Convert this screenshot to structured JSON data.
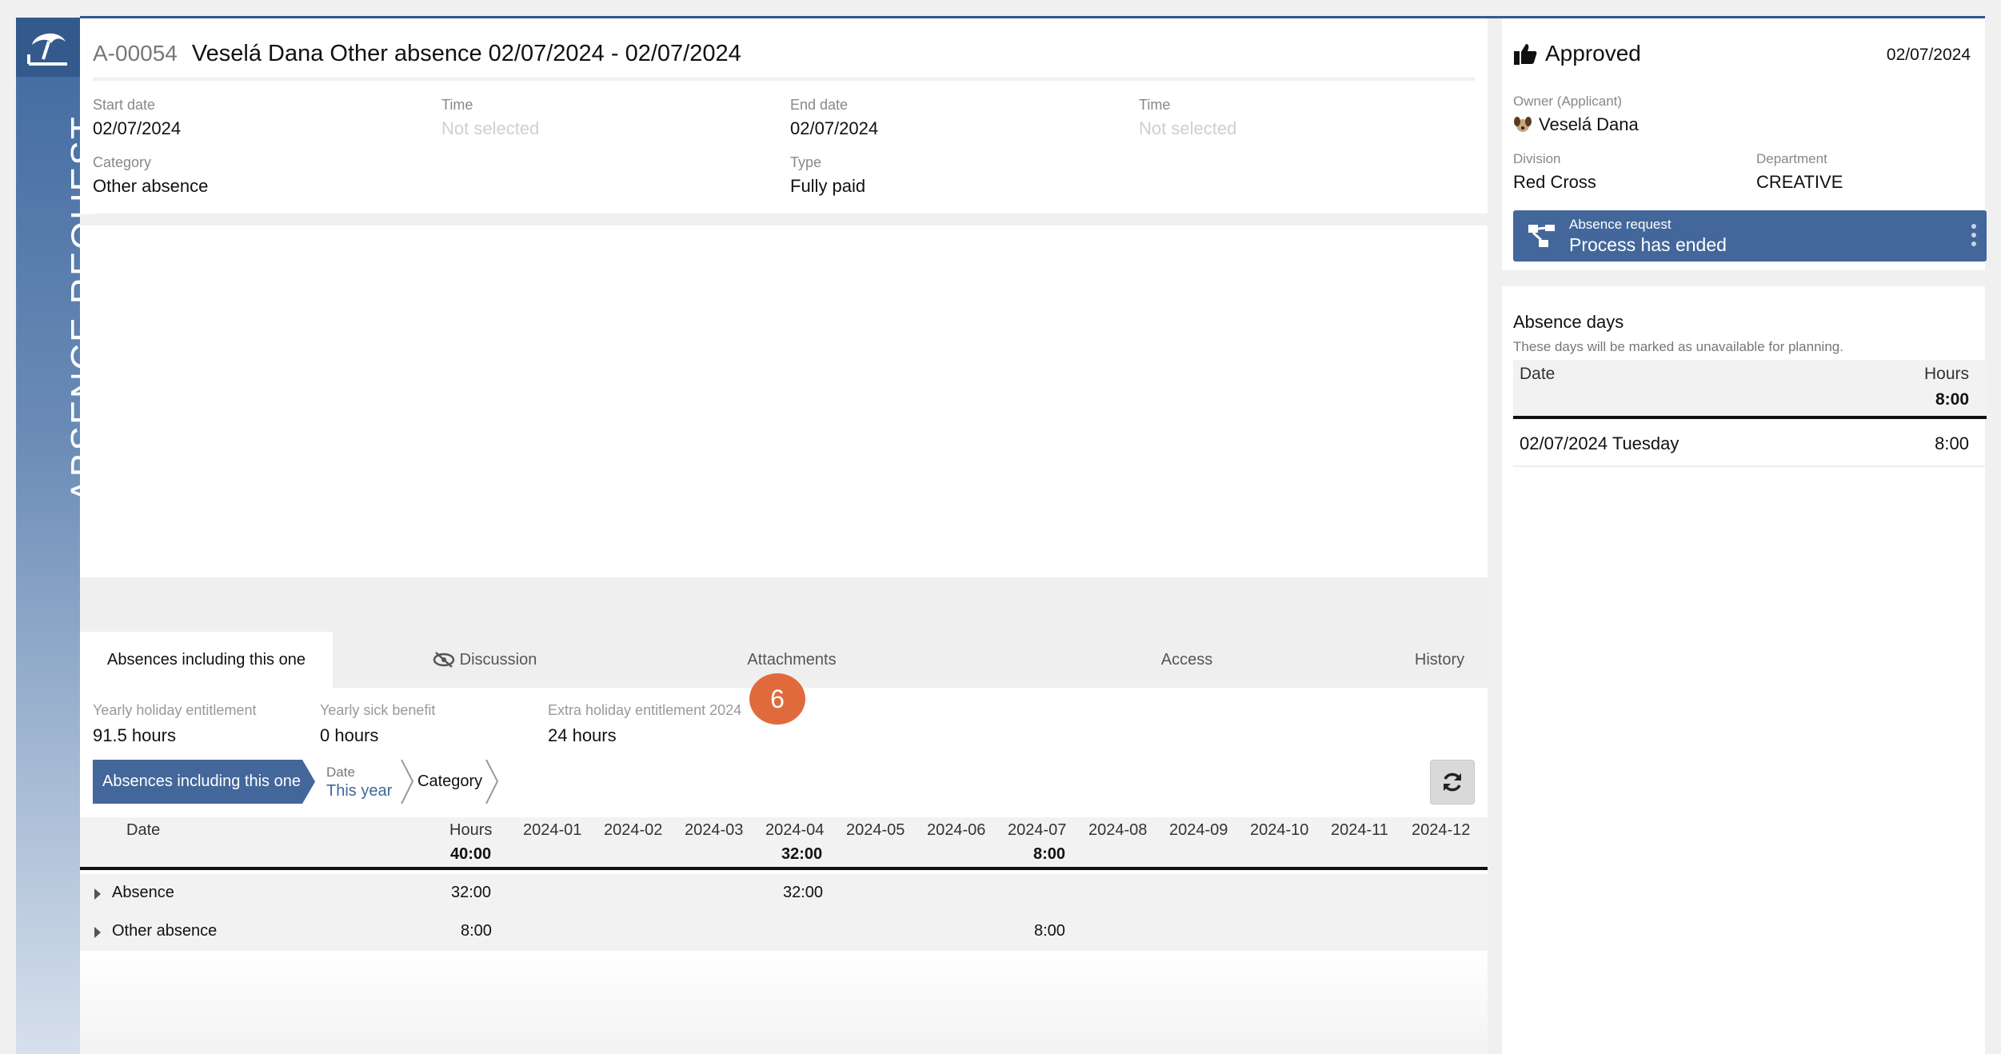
{
  "sidebar": {
    "title": "ABSENCE REQUEST",
    "logo_icon": "beach-umbrella-icon"
  },
  "header": {
    "code": "A-00054",
    "title": "Veselá Dana Other absence 02/07/2024 - 02/07/2024"
  },
  "fields": {
    "start_date": {
      "label": "Start date",
      "value": "02/07/2024"
    },
    "start_time": {
      "label": "Time",
      "value": "Not selected"
    },
    "end_date": {
      "label": "End date",
      "value": "02/07/2024"
    },
    "end_time": {
      "label": "Time",
      "value": "Not selected"
    },
    "category": {
      "label": "Category",
      "value": "Other absence"
    },
    "type": {
      "label": "Type",
      "value": "Fully paid"
    }
  },
  "tabs": [
    {
      "label": "Absences including this one",
      "active": true
    },
    {
      "label": "Discussion",
      "icon": "eye-slash-icon"
    },
    {
      "label": "Attachments"
    },
    {
      "label": "Access"
    },
    {
      "label": "History"
    }
  ],
  "entitlements": [
    {
      "label": "Yearly holiday entitlement",
      "value": "91.5 hours"
    },
    {
      "label": "Yearly sick benefit",
      "value": "0 hours"
    },
    {
      "label": "Extra holiday entitlement 2024",
      "value": "24 hours"
    }
  ],
  "step_badge": "6",
  "breadcrumb": {
    "first": "Absences including this one",
    "date_label": "Date",
    "date_value": "This year",
    "category": "Category"
  },
  "table": {
    "columns": [
      "Date",
      "Hours",
      "2024-01",
      "2024-02",
      "2024-03",
      "2024-04",
      "2024-05",
      "2024-06",
      "2024-07",
      "2024-08",
      "2024-09",
      "2024-10",
      "2024-11",
      "2024-12"
    ],
    "totals": {
      "hours": "40:00",
      "apr": "32:00",
      "jul": "8:00"
    },
    "rows": [
      {
        "label": "Absence",
        "hours": "32:00",
        "apr": "32:00",
        "jul": ""
      },
      {
        "label": "Other absence",
        "hours": "8:00",
        "apr": "",
        "jul": "8:00"
      }
    ]
  },
  "status": {
    "label": "Approved",
    "date": "02/07/2024",
    "icon": "thumbs-up-icon",
    "owner_label": "Owner (Applicant)",
    "owner": "Veselá Dana",
    "division_label": "Division",
    "division": "Red Cross",
    "department_label": "Department",
    "department": "CREATIVE"
  },
  "process": {
    "title": "Absence request",
    "status": "Process has ended"
  },
  "absence_days": {
    "title": "Absence days",
    "subtitle": "These days will be marked as unavailable for planning.",
    "col_date": "Date",
    "col_hours": "Hours",
    "total": "8:00",
    "rows": [
      {
        "date": "02/07/2024 Tuesday",
        "hours": "8:00"
      }
    ]
  },
  "colors": {
    "accent": "#43679a",
    "badge": "#e06a3c"
  }
}
